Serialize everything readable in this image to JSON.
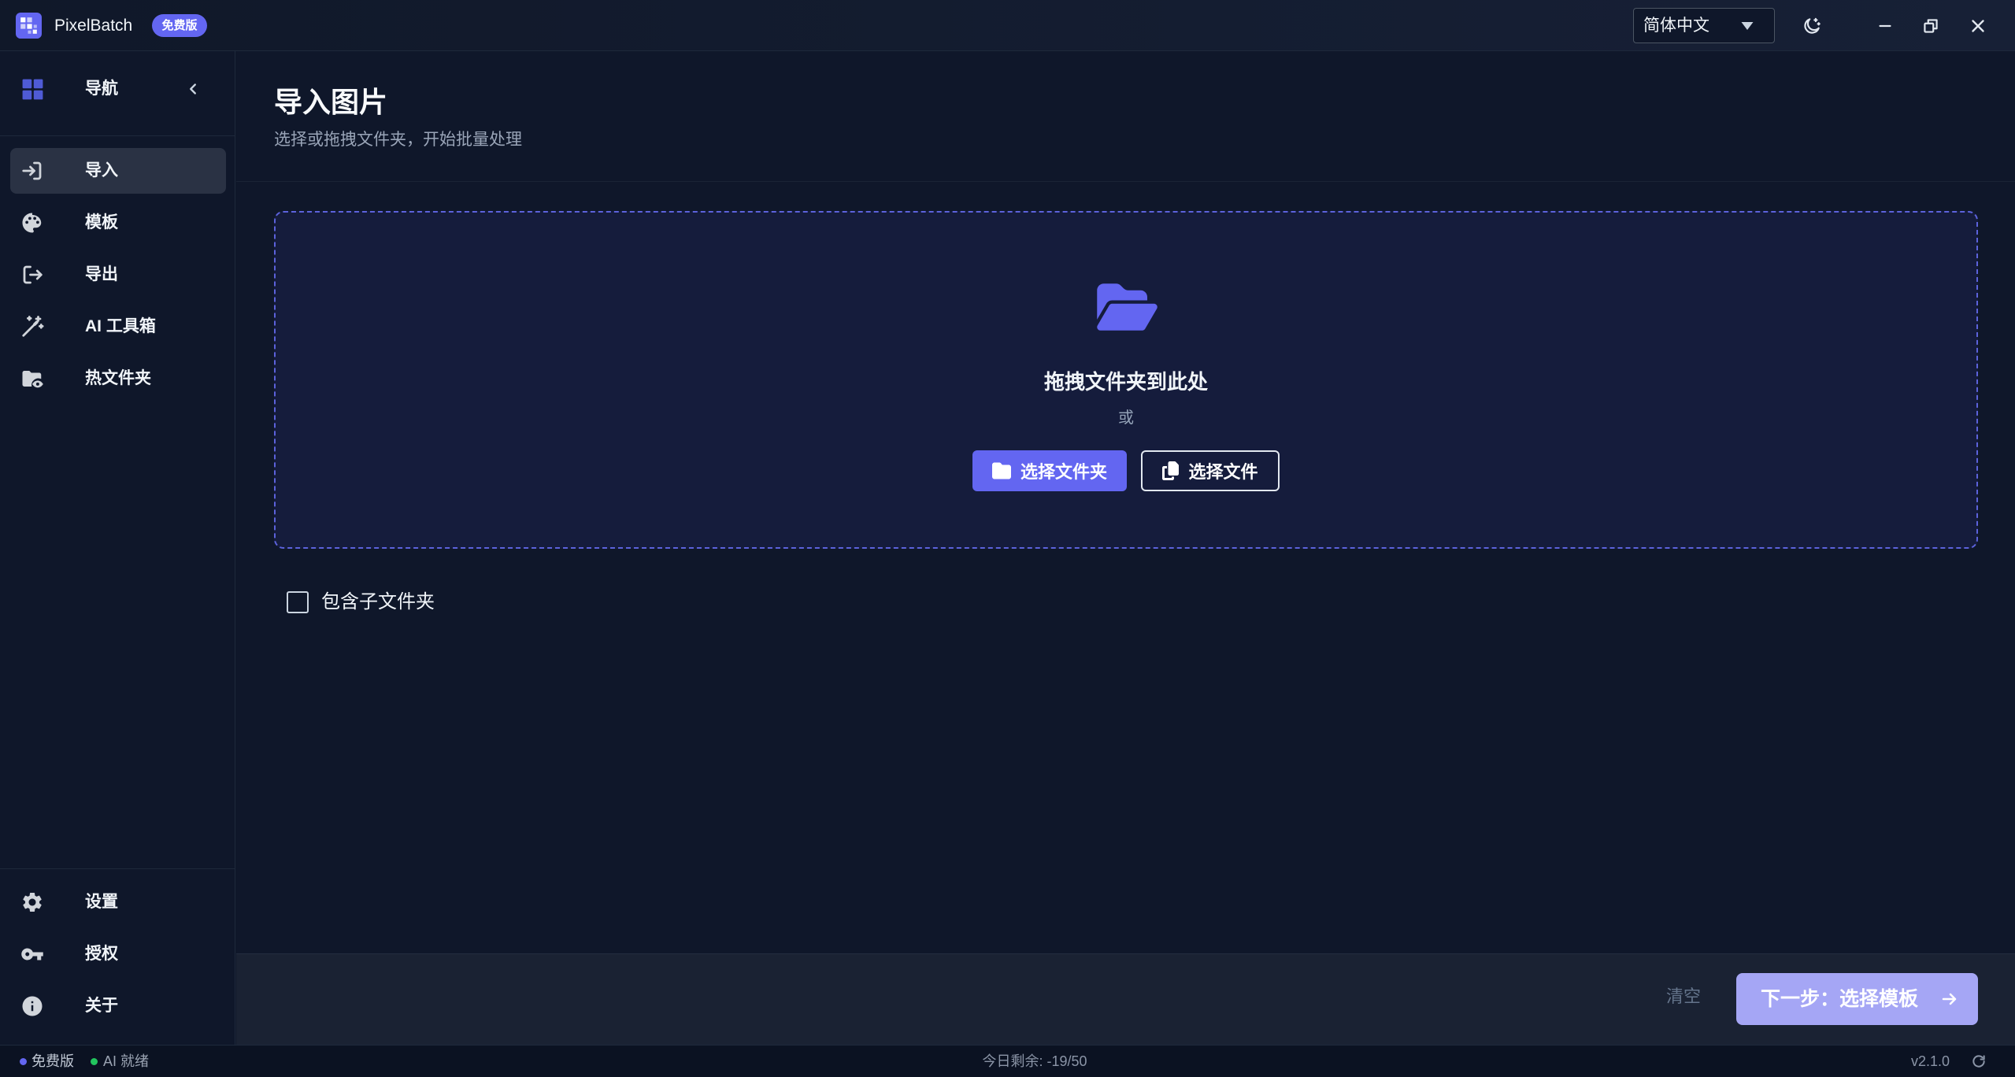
{
  "app": {
    "name": "PixelBatch",
    "badge": "免费版"
  },
  "titlebar": {
    "language": "简体中文",
    "icons": [
      "theme-toggle-icon",
      "minimize-icon",
      "restore-icon",
      "close-icon"
    ]
  },
  "sidebar": {
    "header_label": "导航",
    "items": [
      {
        "label": "导入",
        "icon": "import-icon",
        "active": true
      },
      {
        "label": "模板",
        "icon": "palette-icon",
        "active": false
      },
      {
        "label": "导出",
        "icon": "export-icon",
        "active": false
      },
      {
        "label": "AI 工具箱",
        "icon": "magic-wand-icon",
        "active": false
      },
      {
        "label": "热文件夹",
        "icon": "hot-folder-icon",
        "active": false
      }
    ],
    "bottom_items": [
      {
        "label": "设置",
        "icon": "gear-icon"
      },
      {
        "label": "授权",
        "icon": "key-icon"
      },
      {
        "label": "关于",
        "icon": "info-icon"
      }
    ]
  },
  "page": {
    "title": "导入图片",
    "subtitle": "选择或拖拽文件夹，开始批量处理"
  },
  "dropzone": {
    "prompt": "拖拽文件夹到此处",
    "or": "或",
    "select_folder_label": "选择文件夹",
    "select_files_label": "选择文件"
  },
  "options": {
    "include_subfolders_label": "包含子文件夹",
    "include_subfolders_checked": false
  },
  "actions": {
    "clear_label": "清空",
    "next_label": "下一步：选择模板"
  },
  "statusbar": {
    "plan": "免费版",
    "ai_status": "AI 就绪",
    "quota": "今日剩余: -19/50",
    "version": "v2.1.0"
  },
  "colors": {
    "accent": "#6366f1",
    "background": "#0f172a",
    "dropzone_bg": "#151c3c",
    "dropzone_border": "#5c62dc",
    "next_button_bg": "#a5a6f5",
    "status_ready": "#22c55e"
  }
}
